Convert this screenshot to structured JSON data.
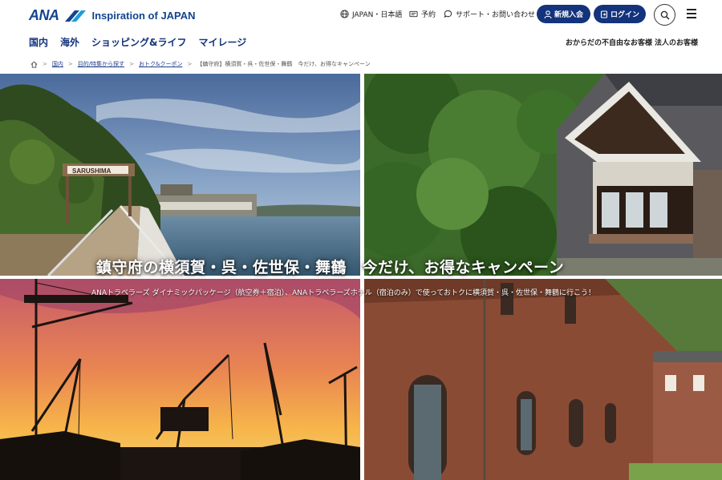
{
  "header": {
    "logo_word": "ANA",
    "tagline": "Inspiration of JAPAN",
    "lang_label": "JAPAN・日本語",
    "booking_label": "予約",
    "support_label": "サポート・お問い合わせ",
    "join_label": "新規入会",
    "login_label": "ログイン"
  },
  "gnav": [
    {
      "label": "国内"
    },
    {
      "label": "海外"
    },
    {
      "label": "ショッピング&ライフ"
    },
    {
      "label": "マイレージ"
    }
  ],
  "subnav": {
    "accessibility": "おからだの不自由なお客様",
    "corporate": "法人のお客様"
  },
  "breadcrumb": [
    "国内",
    "目的/特集から探す",
    "おトク&クーポン",
    "【鎮守府】横須賀・呉・佐世保・舞鶴　今だけ、お得なキャンペーン"
  ],
  "hero": {
    "title": "鎮守府の横須賀・呉・佐世保・舞鶴　今だけ、お得なキャンペーン",
    "subtitle": "ANAトラベラーズ ダイナミックパッケージ（航空券＋宿泊）、ANAトラベラーズホテル（宿泊のみ）で使っておトクに横須賀・呉・佐世保・舞鶴に行こう！",
    "sign_text": "SARUSHIMA"
  },
  "colors": {
    "brand_navy": "#13337c",
    "logo_blue": "#13448f"
  },
  "icons": {
    "lang": "globe-icon",
    "booking": "ticket-icon",
    "support": "chat-icon",
    "join": "user-icon",
    "login": "login-icon",
    "search": "search-icon",
    "menu": "hamburger-menu-icon",
    "home": "home-icon"
  }
}
